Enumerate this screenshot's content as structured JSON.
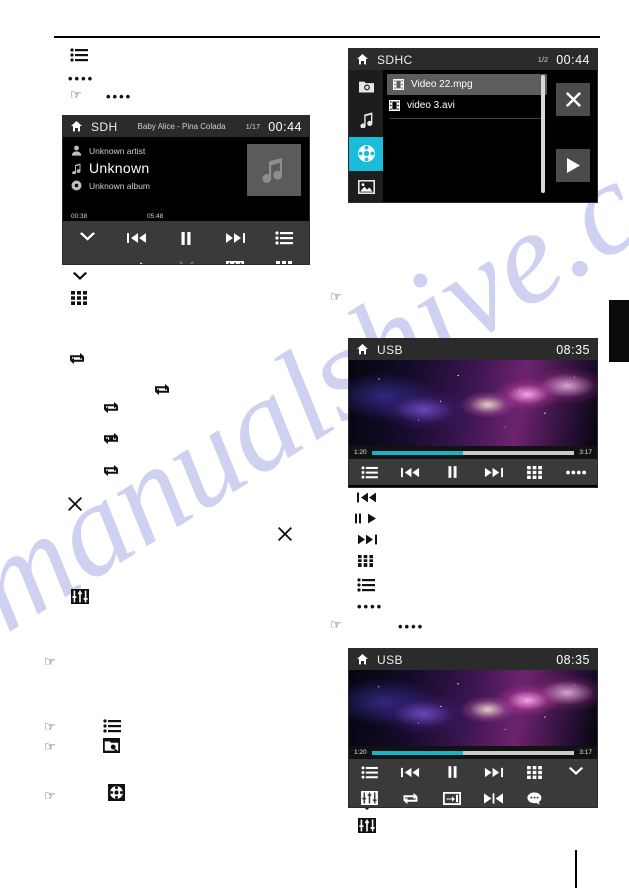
{
  "watermark": {
    "text": "manualshive.com"
  },
  "audio_player": {
    "statusbar": {
      "home_icon": "home-icon",
      "source": "SDH",
      "track_title": "Baby Alice - Pina Colada",
      "track_index": "1/17",
      "clock": "00:44"
    },
    "artist_icon": "person-icon",
    "artist": "Unknown artist",
    "title_icon": "music-note-icon",
    "title": "Unknown",
    "album_icon": "disc-icon",
    "album": "Unknown album",
    "album_art_icon": "music-note-icon",
    "elapsed": "00:38",
    "duration": "05:48",
    "controls_row1": [
      {
        "name": "collapse-chevron-button",
        "icon": "chevron-down-icon",
        "dim": false
      },
      {
        "name": "previous-track-button",
        "icon": "previous-icon",
        "dim": false
      },
      {
        "name": "pause-button",
        "icon": "pause-icon",
        "dim": false
      },
      {
        "name": "next-track-button",
        "icon": "next-icon",
        "dim": false
      },
      {
        "name": "playlist-button",
        "icon": "list-icon",
        "dim": false
      }
    ],
    "controls_row2": [
      {
        "name": "repeat-button",
        "icon": "repeat-icon",
        "dim": false
      },
      {
        "name": "shuffle-button",
        "icon": "shuffle-icon",
        "dim": true
      },
      {
        "name": "equalizer-button",
        "icon": "equalizer-icon",
        "dim": false
      },
      {
        "name": "keypad-button",
        "icon": "grid-icon",
        "dim": false
      }
    ]
  },
  "sdhc_browser": {
    "statusbar": {
      "home_icon": "home-icon",
      "source": "SDHC",
      "page_index": "1/2",
      "clock": "00:44"
    },
    "sidebar": [
      {
        "name": "sidebar-item-browse",
        "icon": "folder-search-icon",
        "active": false
      },
      {
        "name": "sidebar-item-music",
        "icon": "music-note-icon",
        "active": false
      },
      {
        "name": "sidebar-item-video",
        "icon": "film-reel-icon",
        "active": true
      },
      {
        "name": "sidebar-item-photo",
        "icon": "photo-icon",
        "active": false
      }
    ],
    "files": [
      {
        "name": "file-item",
        "icon": "film-strip-icon",
        "label": "Video 22.mpg",
        "selected": true
      },
      {
        "name": "file-item",
        "icon": "film-strip-icon",
        "label": "video 3.avi",
        "selected": false
      }
    ],
    "close_button_icon": "close-icon",
    "play_button_icon": "play-icon"
  },
  "usb_player_1": {
    "statusbar": {
      "home_icon": "home-icon",
      "source": "USB",
      "clock": "08:35"
    },
    "elapsed": "1:20",
    "duration": "3:17",
    "progress_percent": 45,
    "controls_row1": [
      {
        "name": "playlist-button",
        "icon": "list-icon"
      },
      {
        "name": "previous-track-button",
        "icon": "previous-icon"
      },
      {
        "name": "pause-button",
        "icon": "pause-icon"
      },
      {
        "name": "next-track-button",
        "icon": "next-icon"
      },
      {
        "name": "keypad-button",
        "icon": "grid-icon"
      },
      {
        "name": "more-options-button",
        "icon": "ellipsis-icon"
      }
    ]
  },
  "usb_player_2": {
    "statusbar": {
      "home_icon": "home-icon",
      "source": "USB",
      "clock": "08:35"
    },
    "elapsed": "1:20",
    "duration": "3:17",
    "progress_percent": 45,
    "controls_row1": [
      {
        "name": "playlist-button",
        "icon": "list-icon"
      },
      {
        "name": "previous-track-button",
        "icon": "previous-icon"
      },
      {
        "name": "pause-button",
        "icon": "pause-icon"
      },
      {
        "name": "next-track-button",
        "icon": "next-icon"
      },
      {
        "name": "keypad-button",
        "icon": "grid-icon"
      },
      {
        "name": "collapse-chevron-button",
        "icon": "chevron-down-icon"
      }
    ],
    "controls_row2": [
      {
        "name": "equalizer-button",
        "icon": "equalizer-icon"
      },
      {
        "name": "repeat-button",
        "icon": "repeat-icon"
      },
      {
        "name": "screen-size-button",
        "icon": "screen-size-icon"
      },
      {
        "name": "aspect-ratio-button",
        "icon": "aspect-ratio-icon"
      },
      {
        "name": "subtitle-button",
        "icon": "speech-bubble-icon"
      }
    ]
  },
  "doc_icons": {
    "left_col": [
      {
        "name": "list-icon",
        "icon": "list-icon"
      },
      {
        "name": "chevron-down-icon",
        "icon": "chevron-down-icon"
      },
      {
        "name": "grid-icon",
        "icon": "grid-icon"
      },
      {
        "name": "repeat-icon-1",
        "icon": "repeat-icon"
      },
      {
        "name": "repeat-icon-2",
        "icon": "repeat-icon"
      },
      {
        "name": "repeat-icon-3",
        "icon": "repeat-icon"
      },
      {
        "name": "repeat-one-icon",
        "icon": "repeat-one-icon"
      },
      {
        "name": "repeat-icon-4",
        "icon": "repeat-icon"
      },
      {
        "name": "shuffle-icon-1",
        "icon": "shuffle-icon"
      },
      {
        "name": "shuffle-icon-2",
        "icon": "shuffle-icon"
      },
      {
        "name": "equalizer-icon-1",
        "icon": "equalizer-icon"
      },
      {
        "name": "list-icon-2",
        "icon": "list-icon"
      },
      {
        "name": "folder-search-icon",
        "icon": "folder-search-icon"
      },
      {
        "name": "film-reel-icon",
        "icon": "film-reel-icon"
      }
    ],
    "right_col": [
      {
        "name": "previous-icon",
        "icon": "previous-bar-icon"
      },
      {
        "name": "pause-play-icon",
        "icon": "pause-play-icon"
      },
      {
        "name": "next-icon",
        "icon": "next-bar-icon"
      },
      {
        "name": "keypad-bars-icon",
        "icon": "keypad-bars-icon"
      },
      {
        "name": "list-icon-3",
        "icon": "list-icon"
      }
    ]
  },
  "hand_bullets": {
    "glyph": "☞"
  },
  "ellipsis": {
    "glyph": "••••"
  }
}
